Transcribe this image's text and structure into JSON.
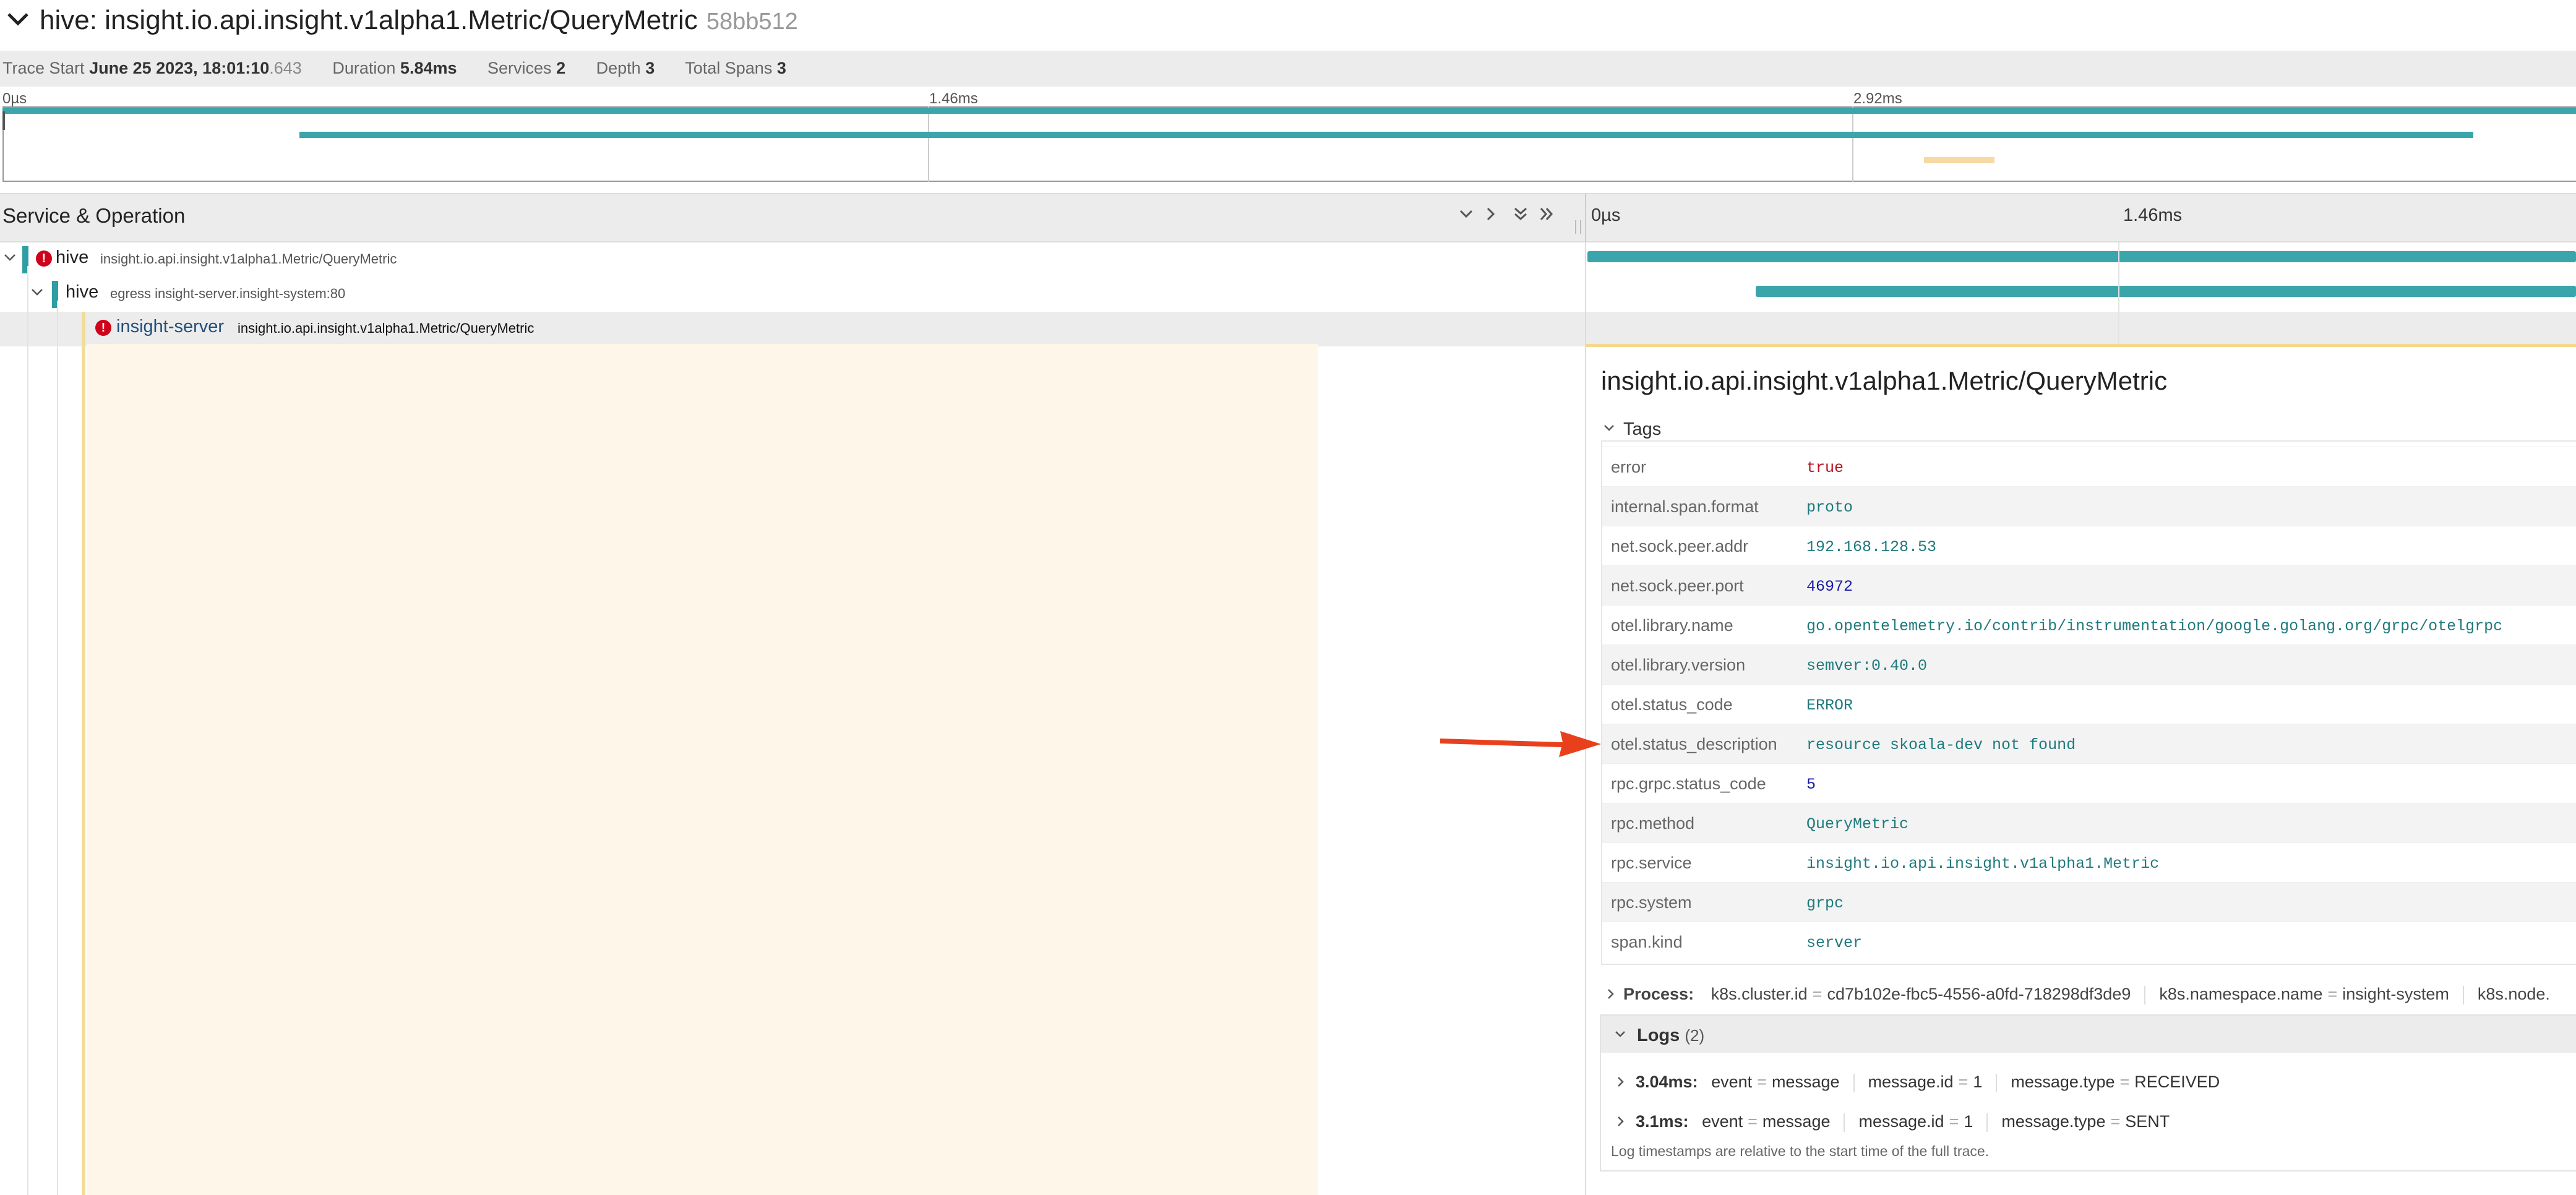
{
  "header": {
    "title": "hive: insight.io.api.insight.v1alpha1.Metric/QueryMetric",
    "trace_id": "58bb512"
  },
  "meta": {
    "trace_start_label": "Trace Start",
    "trace_start_date": "June 25 2023, 18:01:10",
    "trace_start_ms": ".643",
    "duration_label": "Duration",
    "duration": "5.84ms",
    "services_label": "Services",
    "services": "2",
    "depth_label": "Depth",
    "depth": "3",
    "total_spans_label": "Total Spans",
    "total_spans": "3"
  },
  "minimap": {
    "ticks": [
      "0µs",
      "1.46ms",
      "2.92ms"
    ]
  },
  "table_header": {
    "title": "Service & Operation",
    "timeline_ticks": [
      "0µs",
      "1.46ms"
    ]
  },
  "spans": [
    {
      "service": "hive",
      "operation": "insight.io.api.insight.v1alpha1.Metric/QueryMetric",
      "error": true
    },
    {
      "service": "hive",
      "operation": "egress insight-server.insight-system:80",
      "error": false
    },
    {
      "service": "insight-server",
      "operation": "insight.io.api.insight.v1alpha1.Metric/QueryMetric",
      "error": true
    }
  ],
  "detail": {
    "title": "insight.io.api.insight.v1alpha1.Metric/QueryMetric",
    "tags_label": "Tags",
    "tags": [
      {
        "key": "error",
        "value": "true"
      },
      {
        "key": "internal.span.format",
        "value": "proto"
      },
      {
        "key": "net.sock.peer.addr",
        "value": "192.168.128.53"
      },
      {
        "key": "net.sock.peer.port",
        "value": "46972"
      },
      {
        "key": "otel.library.name",
        "value": "go.opentelemetry.io/contrib/instrumentation/google.golang.org/grpc/otelgrpc"
      },
      {
        "key": "otel.library.version",
        "value": "semver:0.40.0"
      },
      {
        "key": "otel.status_code",
        "value": "ERROR"
      },
      {
        "key": "otel.status_description",
        "value": "resource skoala-dev not found"
      },
      {
        "key": "rpc.grpc.status_code",
        "value": "5"
      },
      {
        "key": "rpc.method",
        "value": "QueryMetric"
      },
      {
        "key": "rpc.service",
        "value": "insight.io.api.insight.v1alpha1.Metric"
      },
      {
        "key": "rpc.system",
        "value": "grpc"
      },
      {
        "key": "span.kind",
        "value": "server"
      }
    ],
    "process_label": "Process:",
    "process": [
      {
        "key": "k8s.cluster.id",
        "value": "cd7b102e-fbc5-4556-a0fd-718298df3de9"
      },
      {
        "key": "k8s.namespace.name",
        "value": "insight-system"
      },
      {
        "key": "k8s.node.",
        "value": ""
      }
    ],
    "logs_label": "Logs",
    "logs_count": "(2)",
    "logs": [
      {
        "time": "3.04ms:",
        "event": "message",
        "id": "1",
        "type": "RECEIVED"
      },
      {
        "time": "3.1ms:",
        "event": "message",
        "id": "1",
        "type": "SENT"
      }
    ],
    "logs_note": "Log timestamps are relative to the start time of the full trace."
  },
  "colors": {
    "service_teal": "#2f9ea3",
    "error_red": "#d0021b",
    "value_teal": "#1f7a7e",
    "value_number": "#1a1aa6",
    "value_bool": "#b8141f",
    "arrow_red": "#e8401c",
    "selected_yellow": "#f5d78e"
  }
}
